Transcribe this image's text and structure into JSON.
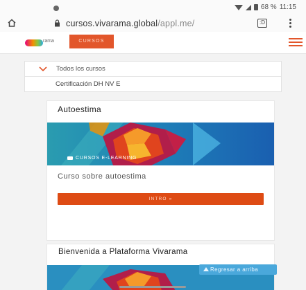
{
  "browser": {
    "status": {
      "battery_text": "68 %",
      "time": "11:15"
    },
    "url": {
      "host": "cursos.vivarama.global",
      "path": "/appl.me/"
    },
    "icons": {
      "home": "home-icon",
      "lock": "lock-icon",
      "tabs": "tabs-icon",
      "menu": "more-vert-icon"
    },
    "tabs_count": ":D"
  },
  "site": {
    "logo_text": "rama",
    "nav_tab": "CURSOS",
    "accent_color": "#e2562b"
  },
  "filter": {
    "category": "Todos los cursos",
    "subcategory": "Certificación DH NV E"
  },
  "courses": [
    {
      "title": "Autoestima",
      "category_tag": "CURSOS E-LEARNING",
      "description": "Curso sobre autoestima",
      "button_label": "INTRO »"
    },
    {
      "title": "Bienvenida a Plataforma Vivarama"
    }
  ],
  "back_to_top": "Regresar a arriba",
  "colors": {
    "button": "#de4b14",
    "back_to_top": "#4aa8db"
  }
}
